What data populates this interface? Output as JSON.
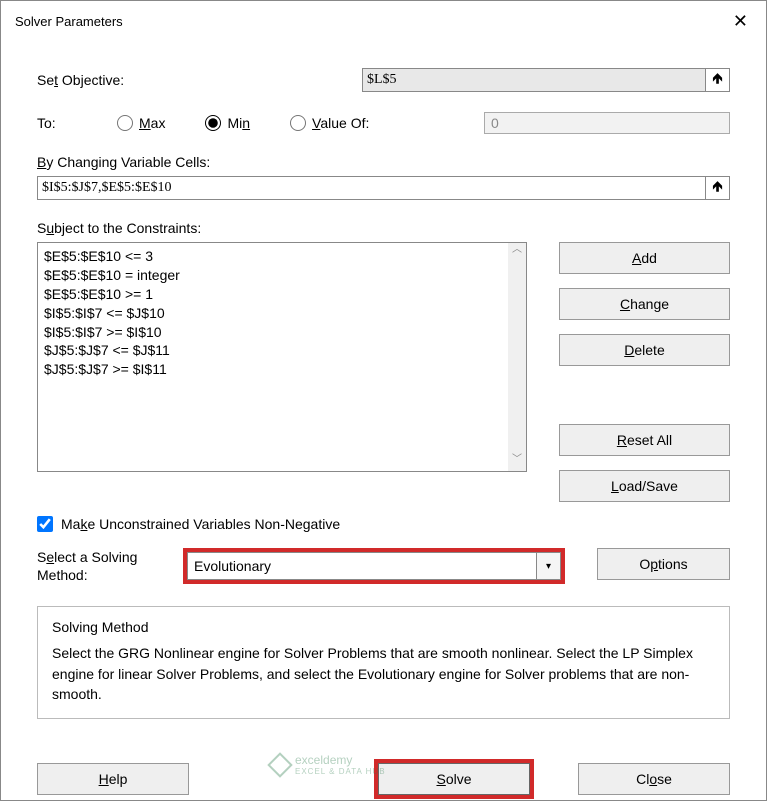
{
  "title": "Solver Parameters",
  "labels": {
    "set_objective": "Set Objective:",
    "to": "To:",
    "max": "Max",
    "min": "Min",
    "value_of": "Value Of:",
    "by_changing": "By Changing Variable Cells:",
    "subject_to": "Subject to the Constraints:",
    "unconstrained": "Make Unconstrained Variables Non-Negative",
    "select_method": "Select a Solving Method:",
    "group_title": "Solving Method",
    "group_text": "Select the GRG Nonlinear engine for Solver Problems that are smooth nonlinear. Select the LP Simplex engine for linear Solver Problems, and select the Evolutionary engine for Solver problems that are non-smooth."
  },
  "values": {
    "objective": "$L$5",
    "value_of": "0",
    "changing": "$I$5:$J$7,$E$5:$E$10",
    "method": "Evolutionary"
  },
  "constraints": [
    "$E$5:$E$10 <= 3",
    "$E$5:$E$10 = integer",
    "$E$5:$E$10 >= 1",
    "$I$5:$I$7 <= $J$10",
    "$I$5:$I$7 >= $I$10",
    "$J$5:$J$7 <= $J$11",
    "$J$5:$J$7 >= $I$11"
  ],
  "buttons": {
    "add": "Add",
    "change": "Change",
    "delete": "Delete",
    "reset": "Reset All",
    "loadsave": "Load/Save",
    "options": "Options",
    "help": "Help",
    "solve": "Solve",
    "close": "Close"
  },
  "watermark": {
    "brand": "exceldemy",
    "sub": "EXCEL & DATA HUB"
  }
}
